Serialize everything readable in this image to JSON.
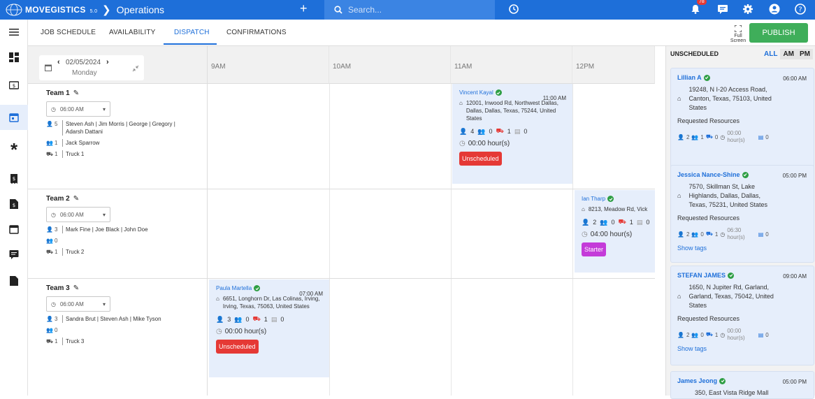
{
  "app": {
    "brand": "MOVEGISTICS",
    "version": "5.0",
    "section": "Operations",
    "notification_count": "78"
  },
  "search": {
    "placeholder": "Search..."
  },
  "tabs": [
    {
      "label": "JOB SCHEDULE"
    },
    {
      "label": "AVAILABILITY"
    },
    {
      "label": "DISPATCH"
    },
    {
      "label": "CONFIRMATIONS"
    }
  ],
  "toolbar": {
    "fullscreen_label": "Full Screen",
    "publish_label": "PUBLISH"
  },
  "date": {
    "value": "02/05/2024",
    "weekday": "Monday"
  },
  "hours": [
    "9AM",
    "10AM",
    "11AM",
    "12PM"
  ],
  "teams": [
    {
      "name": "Team 1",
      "start": "06:00 AM",
      "crew_count": "5",
      "crew": "Steven Ash | Jim Morris | George | Gregory | Adarsh Dattani",
      "drivers_count": "1",
      "drivers": "Jack Sparrow",
      "trucks_count": "1",
      "trucks": "Truck 1"
    },
    {
      "name": "Team 2",
      "start": "06:00 AM",
      "crew_count": "3",
      "crew": "Mark Fine | Joe Black | John Doe",
      "drivers_count": "0",
      "drivers": "",
      "trucks_count": "1",
      "trucks": "Truck 2"
    },
    {
      "name": "Team 3",
      "start": "06:00 AM",
      "crew_count": "3",
      "crew": "Sandra Brut | Steven Ash | Mike Tyson",
      "drivers_count": "0",
      "drivers": "",
      "trucks_count": "1",
      "trucks": "Truck 3"
    }
  ],
  "jobs": [
    {
      "name": "Vincent Kayal",
      "time": "11:00 AM",
      "address": "12001, Inwood Rd, Northwest Dallas, Dallas, Dallas, Texas, 75244, United States",
      "crew": "4",
      "drivers": "0",
      "trucks": "1",
      "other": "0",
      "duration": "00:00 hour(s)",
      "status": "Unscheduled",
      "status_color": "#e53935",
      "count_color": "#e53935"
    },
    {
      "name": "Ian Tharp",
      "time": "",
      "address": "8213, Meadow Rd, Vick",
      "crew": "2",
      "drivers": "0",
      "trucks": "1",
      "other": "0",
      "duration": "04:00 hour(s)",
      "status": "Starter",
      "status_color": "#c43bd9",
      "count_color": "#e53935"
    },
    {
      "name": "Paula Martella",
      "time": "07:00 AM",
      "address": "6651, Longhorn Dr, Las Colinas, Irving, Irving, Texas, 75063, United States",
      "crew": "3",
      "drivers": "0",
      "trucks": "1",
      "other": "0",
      "duration": "00:00 hour(s)",
      "status": "Unscheduled",
      "status_color": "#e53935",
      "count_color": "#2e9e44"
    }
  ],
  "unscheduled": {
    "title": "UNSCHEDULED",
    "filters": [
      "ALL",
      "AM",
      "PM"
    ],
    "cards": [
      {
        "name": "Lillian A",
        "time": "06:00 AM",
        "address": "19248, N I-20 Access Road, Canton, Texas, 75103, United States",
        "req_label": "Requested Resources",
        "crew": "2",
        "drivers": "1",
        "trucks": "0",
        "duration": "00:00",
        "duration_unit": "hour(s)",
        "other": "0",
        "tags": ""
      },
      {
        "name": "Jessica Nance-Shine",
        "time": "05:00 PM",
        "address": "7570, Skillman St, Lake Highlands, Dallas, Dallas, Texas, 75231, United States",
        "req_label": "Requested Resources",
        "crew": "2",
        "drivers": "0",
        "trucks": "1",
        "duration": "06:30",
        "duration_unit": "hour(s)",
        "other": "0",
        "tags": "Show tags"
      },
      {
        "name": "STEFAN JAMES",
        "time": "09:00 AM",
        "address": "1650, N Jupiter Rd, Garland, Garland, Texas, 75042, United States",
        "req_label": "Requested Resources",
        "crew": "2",
        "drivers": "0",
        "trucks": "1",
        "duration": "00:00",
        "duration_unit": "hour(s)",
        "other": "0",
        "tags": "Show tags"
      },
      {
        "name": "James Jeong",
        "time": "05:00 PM",
        "address": "350, East Vista Ridge Mall",
        "req_label": "",
        "crew": "",
        "drivers": "",
        "trucks": "",
        "duration": "",
        "duration_unit": "",
        "other": "",
        "tags": ""
      }
    ]
  },
  "icons": {
    "nav": [
      "grid-icon",
      "money-icon",
      "calendar-icon",
      "asterisk-icon",
      "receipt-icon",
      "invoice-icon",
      "calendar-icon",
      "message-icon",
      "document-icon"
    ]
  },
  "colors": {
    "primary": "#1e6fd9",
    "publish": "#3fae5a",
    "card_bg": "#e6eefb"
  }
}
